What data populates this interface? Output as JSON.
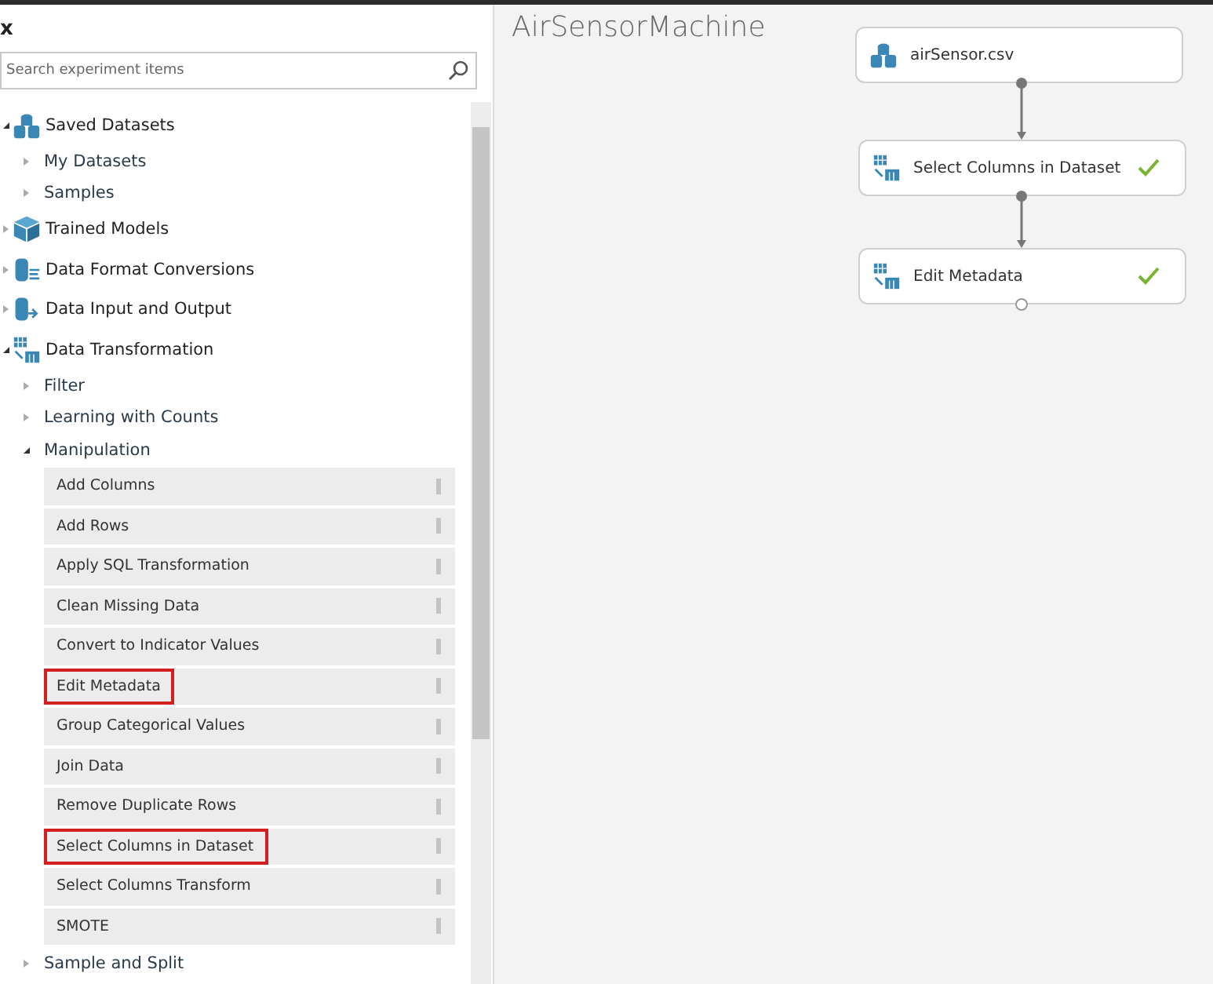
{
  "palette": {
    "close_glyph": "x",
    "search": {
      "placeholder": "Search experiment items"
    },
    "tree": [
      {
        "label": "Saved Datasets",
        "kind": "dataset",
        "expanded": true,
        "children": [
          {
            "label": "My Datasets",
            "expanded": false
          },
          {
            "label": "Samples",
            "expanded": false
          }
        ]
      },
      {
        "label": "Trained Models",
        "kind": "cube",
        "expanded": false
      },
      {
        "label": "Data Format Conversions",
        "kind": "convert",
        "expanded": false
      },
      {
        "label": "Data Input and Output",
        "kind": "io",
        "expanded": false
      },
      {
        "label": "Data Transformation",
        "kind": "transform",
        "expanded": true,
        "children": [
          {
            "label": "Filter",
            "expanded": false
          },
          {
            "label": "Learning with Counts",
            "expanded": false
          },
          {
            "label": "Manipulation",
            "expanded": true,
            "modules": [
              {
                "label": "Add Columns",
                "highlighted": false
              },
              {
                "label": "Add Rows",
                "highlighted": false
              },
              {
                "label": "Apply SQL Transformation",
                "highlighted": false
              },
              {
                "label": "Clean Missing Data",
                "highlighted": false
              },
              {
                "label": "Convert to Indicator Values",
                "highlighted": false
              },
              {
                "label": "Edit Metadata",
                "highlighted": true
              },
              {
                "label": "Group Categorical Values",
                "highlighted": false
              },
              {
                "label": "Join Data",
                "highlighted": false
              },
              {
                "label": "Remove Duplicate Rows",
                "highlighted": false
              },
              {
                "label": "Select Columns in Dataset",
                "highlighted": true
              },
              {
                "label": "Select Columns Transform",
                "highlighted": false
              },
              {
                "label": "SMOTE",
                "highlighted": false
              }
            ]
          },
          {
            "label": "Sample and Split",
            "expanded": false
          }
        ]
      }
    ]
  },
  "canvas": {
    "title": "AirSensorMachine",
    "nodes": [
      {
        "label": "airSensor.csv",
        "kind": "dataset",
        "completed": false,
        "output_connected": true
      },
      {
        "label": "Select Columns in Dataset",
        "kind": "transform",
        "completed": true,
        "output_connected": true
      },
      {
        "label": "Edit Metadata",
        "kind": "transform",
        "completed": true,
        "output_connected": false
      }
    ]
  }
}
